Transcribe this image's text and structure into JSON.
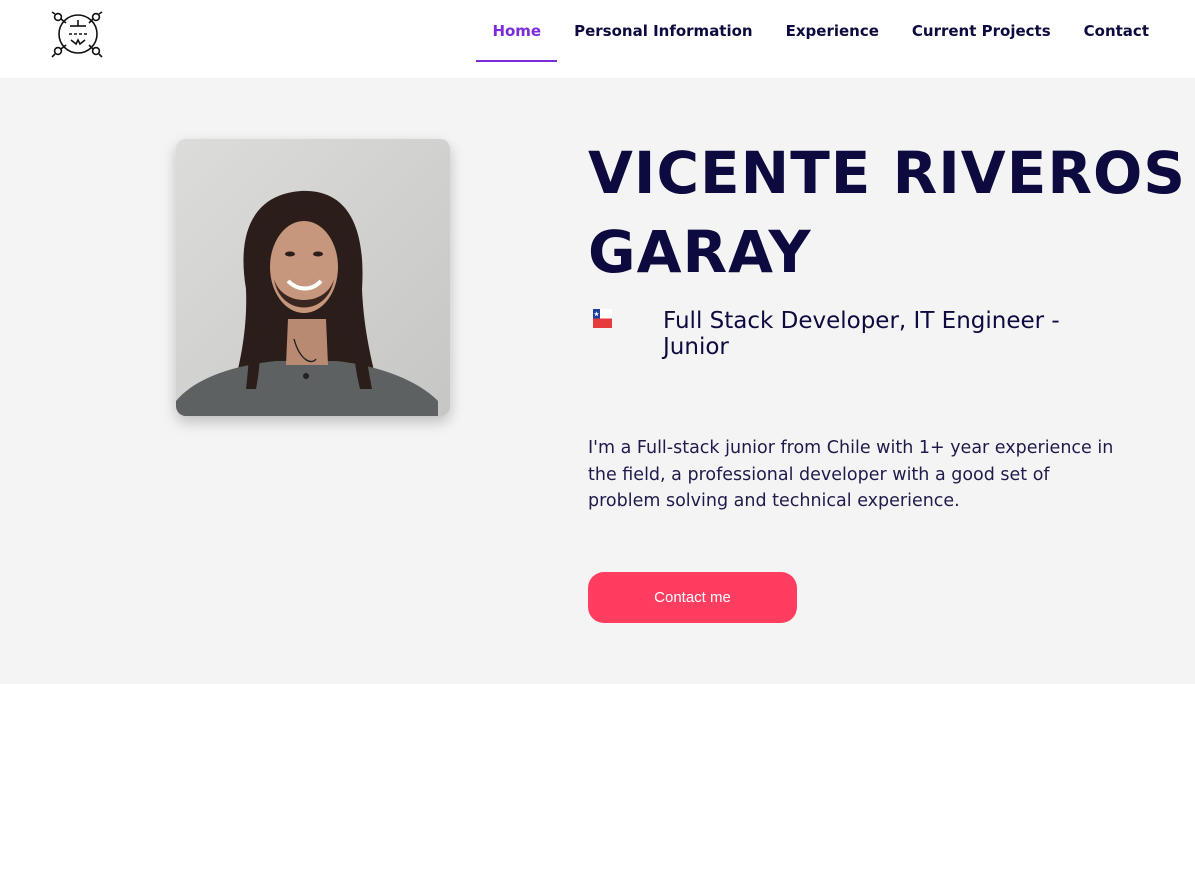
{
  "header": {
    "logo_icon": "circuit-tube-logo",
    "nav": [
      {
        "label": "Home",
        "active": true
      },
      {
        "label": "Personal Information",
        "active": false
      },
      {
        "label": "Experience",
        "active": false
      },
      {
        "label": "Current Projects",
        "active": false
      },
      {
        "label": "Contact",
        "active": false
      }
    ]
  },
  "hero": {
    "name": "VICENTE RIVEROS GARAY",
    "flag_icon": "chile-flag-icon",
    "role": "Full Stack Developer, IT Engineer - Junior",
    "bio": "I'm a Full-stack junior from Chile with 1+ year experience in the field, a professional developer with a good set of problem solving and technical experience.",
    "cta_label": "Contact me",
    "photo_icon": "profile-photo"
  },
  "colors": {
    "accent": "#7b2bd9",
    "text_dark": "#0c0a3e",
    "cta": "#ff3d60",
    "hero_bg": "#f4f4f4"
  }
}
